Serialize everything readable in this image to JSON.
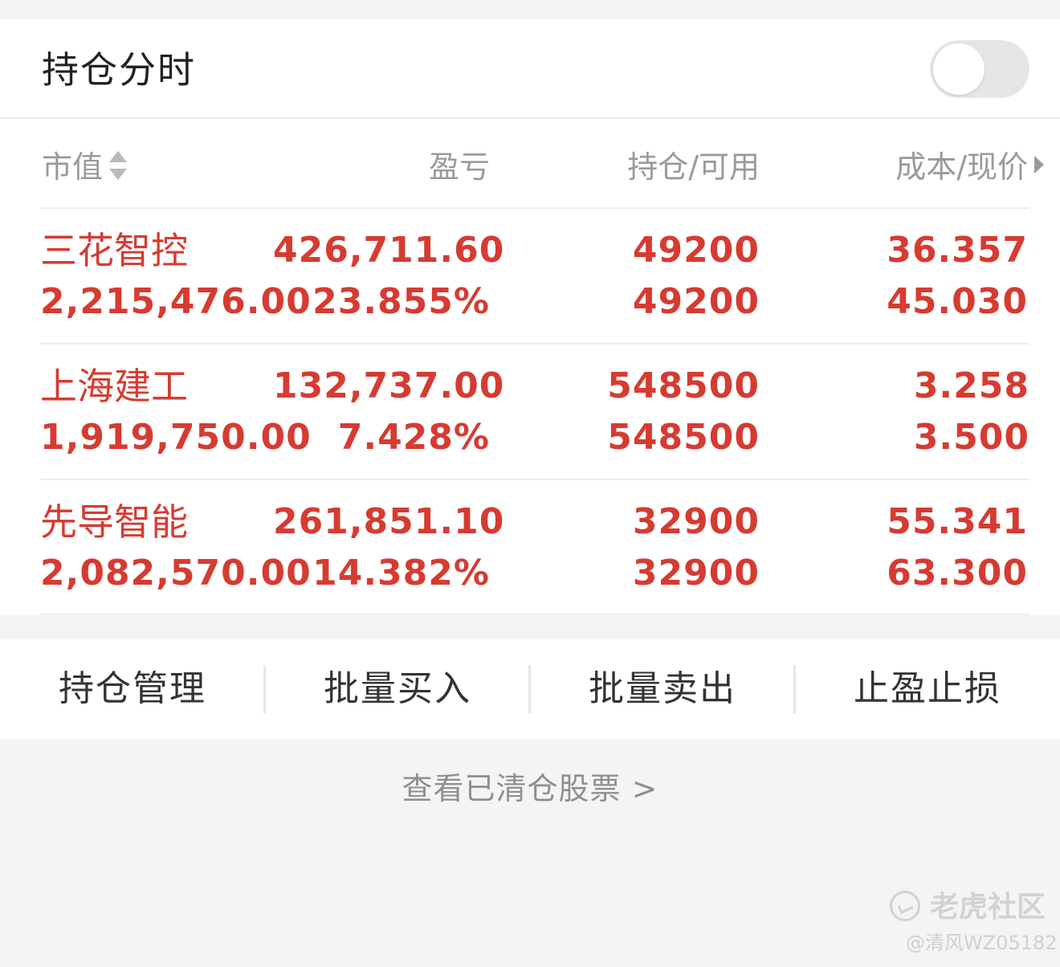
{
  "header": {
    "title": "持仓分时",
    "toggle_on": false
  },
  "columns": {
    "market_value": "市值",
    "profit_loss": "盈亏",
    "position_available": "持仓/可用",
    "cost_price": "成本/现价"
  },
  "holdings": [
    {
      "name": "三花智控",
      "market_value": "2,215,476.00",
      "pnl_amount": "426,711.60",
      "pnl_percent": "23.855%",
      "position": "49200",
      "available": "49200",
      "cost": "36.357",
      "price": "45.030"
    },
    {
      "name": "上海建工",
      "market_value": "1,919,750.00",
      "pnl_amount": "132,737.00",
      "pnl_percent": "7.428%",
      "position": "548500",
      "available": "548500",
      "cost": "3.258",
      "price": "3.500"
    },
    {
      "name": "先导智能",
      "market_value": "2,082,570.00",
      "pnl_amount": "261,851.10",
      "pnl_percent": "14.382%",
      "position": "32900",
      "available": "32900",
      "cost": "55.341",
      "price": "63.300"
    }
  ],
  "actions": [
    "持仓管理",
    "批量买入",
    "批量卖出",
    "止盈止损"
  ],
  "cleared_link": "查看已清仓股票 >",
  "watermark": {
    "brand": "老虎社区",
    "user": "@清风WZ05182"
  },
  "colors": {
    "accent_red": "#d63b31",
    "header_gray": "#9a9a9a",
    "background": "#f4f4f4"
  }
}
